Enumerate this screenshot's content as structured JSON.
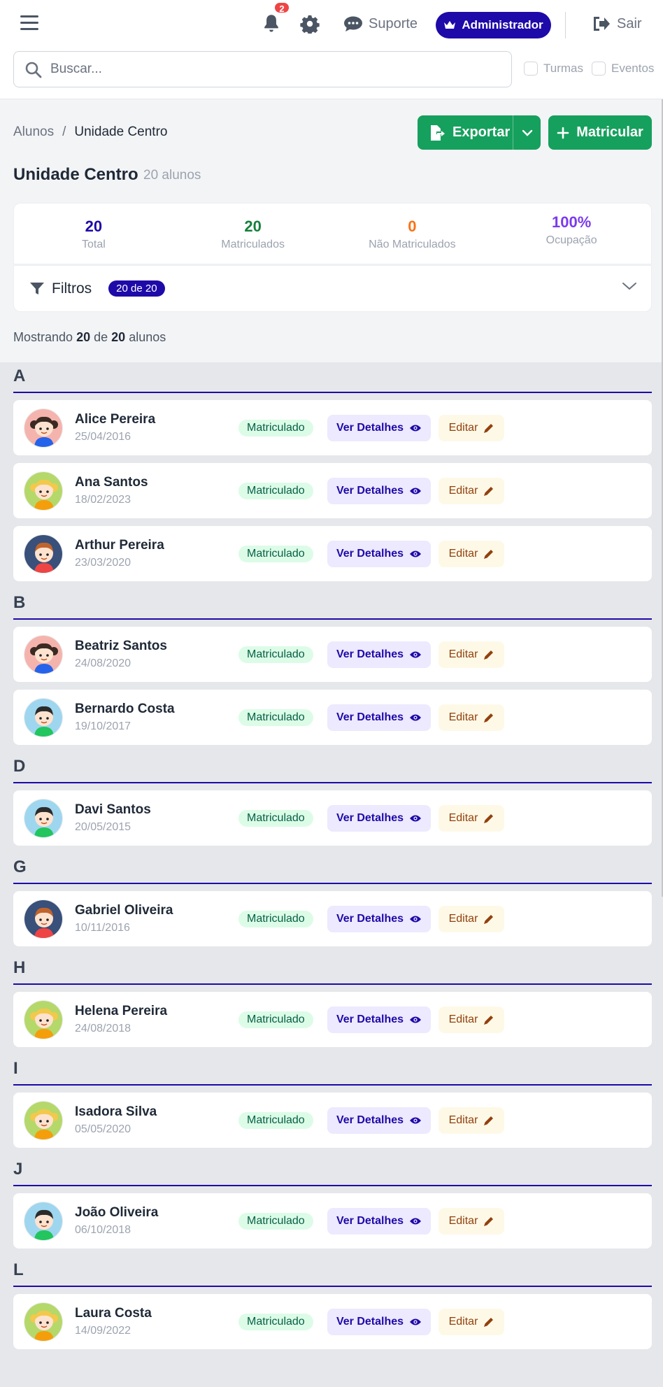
{
  "header": {
    "notifications_count": "2",
    "support_label": "Suporte",
    "admin_label": "Administrador",
    "logout_label": "Sair",
    "search_placeholder": "Buscar...",
    "filter_classes_label": "Turmas",
    "filter_events_label": "Eventos"
  },
  "breadcrumb": [
    "Alunos",
    "/",
    "Unidade Centro"
  ],
  "actions": {
    "export_label": "Exportar",
    "enroll_label": "Matricular"
  },
  "page": {
    "title": "Unidade Centro",
    "count": "20 alunos"
  },
  "stats": [
    {
      "value": "20",
      "label": "Total",
      "color": "#1e0aa8"
    },
    {
      "value": "20",
      "label": "Matriculados",
      "color": "#15803d"
    },
    {
      "value": "0",
      "label": "Não Matriculados",
      "color": "#f97316"
    },
    {
      "value": "100%",
      "label": "Ocupação",
      "color": "#7c3aed"
    }
  ],
  "filters": {
    "label": "Filtros",
    "badge": "20 de 20"
  },
  "showing": {
    "prefix": "Mostrando",
    "shown": "20",
    "middle": "de",
    "total": "20",
    "suffix": "alunos"
  },
  "row_actions": {
    "details_label": "Ver Detalhes",
    "edit_label": "Editar"
  },
  "groups": [
    {
      "letter": "A",
      "students": [
        {
          "name": "Alice Pereira",
          "birth": "25/04/2016",
          "status": "Matriculado",
          "avatar": "girl-dark-hair",
          "avatar_bg": "#f4b4ad"
        },
        {
          "name": "Ana Santos",
          "birth": "18/02/2023",
          "status": "Matriculado",
          "avatar": "girl-blonde",
          "avatar_bg": "#b5d86a"
        },
        {
          "name": "Arthur Pereira",
          "birth": "23/03/2020",
          "status": "Matriculado",
          "avatar": "boy-red-hair",
          "avatar_bg": "#38507a"
        }
      ]
    },
    {
      "letter": "B",
      "students": [
        {
          "name": "Beatriz Santos",
          "birth": "24/08/2020",
          "status": "Matriculado",
          "avatar": "girl-dark-hair",
          "avatar_bg": "#f4b4ad"
        },
        {
          "name": "Bernardo Costa",
          "birth": "19/10/2017",
          "status": "Matriculado",
          "avatar": "boy-dark-hair",
          "avatar_bg": "#9fd6ef"
        }
      ]
    },
    {
      "letter": "D",
      "students": [
        {
          "name": "Davi Santos",
          "birth": "20/05/2015",
          "status": "Matriculado",
          "avatar": "boy-dark-hair",
          "avatar_bg": "#9fd6ef"
        }
      ]
    },
    {
      "letter": "G",
      "students": [
        {
          "name": "Gabriel Oliveira",
          "birth": "10/11/2016",
          "status": "Matriculado",
          "avatar": "boy-red-hair",
          "avatar_bg": "#38507a"
        }
      ]
    },
    {
      "letter": "H",
      "students": [
        {
          "name": "Helena Pereira",
          "birth": "24/08/2018",
          "status": "Matriculado",
          "avatar": "girl-blonde",
          "avatar_bg": "#b5d86a"
        }
      ]
    },
    {
      "letter": "I",
      "students": [
        {
          "name": "Isadora Silva",
          "birth": "05/05/2020",
          "status": "Matriculado",
          "avatar": "girl-blonde",
          "avatar_bg": "#b5d86a"
        }
      ]
    },
    {
      "letter": "J",
      "students": [
        {
          "name": "João Oliveira",
          "birth": "06/10/2018",
          "status": "Matriculado",
          "avatar": "boy-dark-hair",
          "avatar_bg": "#9fd6ef"
        }
      ]
    },
    {
      "letter": "L",
      "students": [
        {
          "name": "Laura Costa",
          "birth": "14/09/2022",
          "status": "Matriculado",
          "avatar": "girl-blonde",
          "avatar_bg": "#b5d86a"
        }
      ]
    }
  ]
}
